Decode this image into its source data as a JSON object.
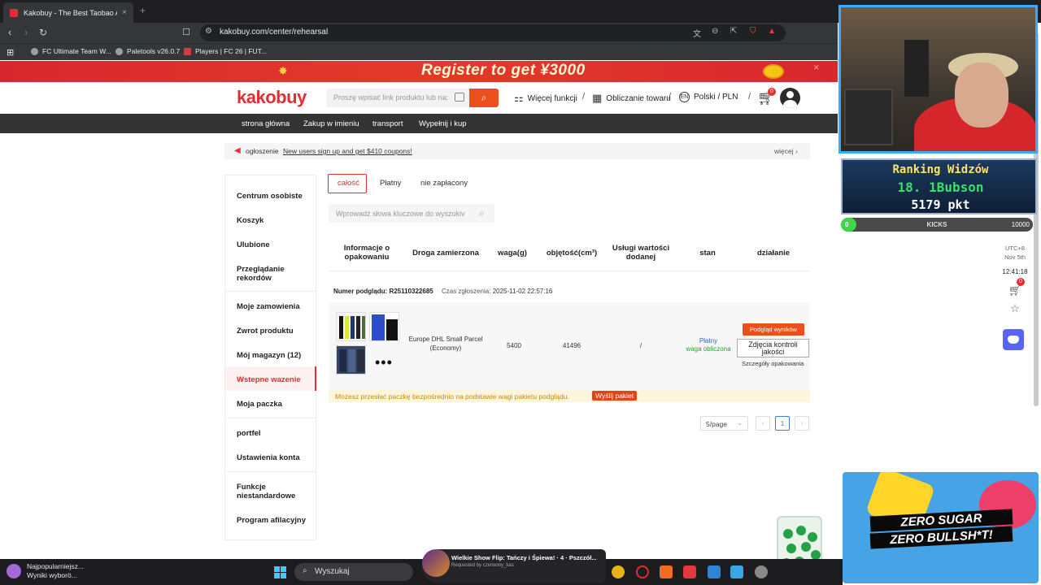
{
  "browser": {
    "tab_title": "Kakobuy - The Best Taobao Age",
    "tab_close": "×",
    "new_tab": "+",
    "url": "kakobuy.com/center/rehearsal",
    "bookmarks": [
      "FC Ultimate Team W...",
      "Paletools v26.0.7",
      "Players | FC 26 | FUT..."
    ]
  },
  "banner": {
    "text": "Register to get ¥3000"
  },
  "header": {
    "logo": "kakobuy",
    "search_placeholder": "Proszę wpisać link produktu lub naz",
    "more_functions": "Więcej funkcji",
    "calc": "Obliczanie towaru",
    "lang": "Polski / PLN",
    "lang_code": "EN",
    "cart_count": "0"
  },
  "mainnav": [
    "strona główna",
    "Zakup w imieniu",
    "transport",
    "Wypełnij i kup"
  ],
  "notice": {
    "label": "ogłoszenie",
    "message": "New users sign up and get $410 coupons!",
    "more": "więcej"
  },
  "sidebar": {
    "items": [
      "Centrum osobiste",
      "Koszyk",
      "Ulubione",
      "Przeglądanie rekordów",
      "Moje zamowienia",
      "Zwrot produktu",
      "Mój magazyn  (12)",
      "Wstepne wazenie",
      "Moja paczka",
      "portfel",
      "Ustawienia konta",
      "Funkcje niestandardowe",
      "Program afilacyjny"
    ]
  },
  "filters": {
    "all": "całość",
    "paid": "Płatny",
    "unpaid": "nie zapłacony",
    "keyword_placeholder": "Wprowadź słowa kluczowe do wyszukiv"
  },
  "table": {
    "headers": [
      "Informacje o opakowaniu",
      "Droga zamierzona",
      "waga(g)",
      "objętość(cm³)",
      "Usługi wartości dodanej",
      "stan",
      "działanie"
    ]
  },
  "package": {
    "number_label": "Numer podglądu:",
    "number": "R25110322685",
    "time_label": "Czas zgłoszenia:",
    "time": "2025-11-02 22:57:16",
    "route": "Europe DHL Small Parcel (Economy)",
    "weight": "5400",
    "volume": "41496",
    "vas": "/",
    "status_paid": "Płatny",
    "status_weight": "waga obliczona",
    "btn_results": "Podgląd wyników",
    "btn_photos": "Zdjęcia kontroli jakości",
    "details": "Szczegóły opakowania",
    "more_dots": "•••"
  },
  "hint": {
    "message": "Możesz przesłać paczkę bezpośrednio na podstawie wagi pakietu podglądu.",
    "button": "Wyślij pakiet"
  },
  "pager": {
    "size": "5/page",
    "current": "1",
    "prev": "‹",
    "next": "›"
  },
  "float": {
    "tz1": "UTC+8",
    "tz2": "Nov 5th",
    "clock": "12:41:18",
    "cart_count": "0"
  },
  "stream": {
    "ranking_title": "Ranking Widzów",
    "rank_no": "18.",
    "rank_name": "1Bubson",
    "points": "5179 pkt",
    "kicks_start": "0",
    "kicks_label": "KICKS",
    "kicks_end": "10000",
    "kicks_progress": 0.08,
    "ad_line1": "ZERO SUGAR",
    "ad_line2": "ZERO BULLSH*T!"
  },
  "taskbar": {
    "news_title": "Najpopularniejsz...",
    "news_sub": "Wyniki wyborö...",
    "search": "Wyszukaj",
    "music_title": "Wielkie Show Flip: Tańczy i Śpiewa! · 4 · Pszczół...",
    "music_sub": "Requested by czerwony_kas"
  },
  "colors": {
    "brand": "#e22d32",
    "accent": "#ea4f1d",
    "nav": "#333333",
    "hint_bg": "#fdf5dc",
    "hint_text": "#c98a0e"
  }
}
